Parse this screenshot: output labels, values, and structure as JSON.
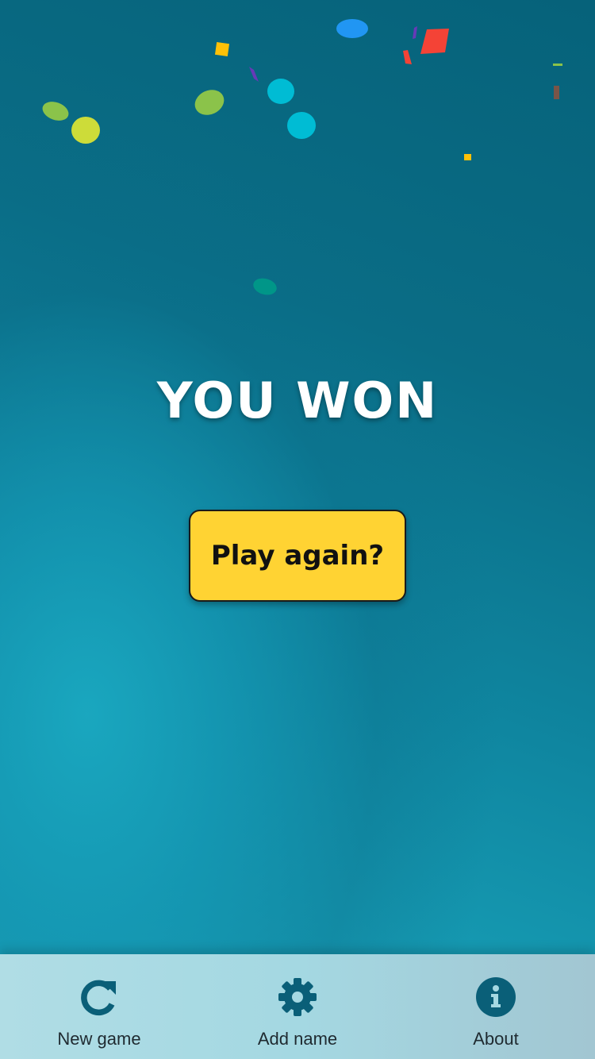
{
  "colors": {
    "background_dark": "#06627a",
    "background_light": "#1aa6bd",
    "title_text": "#ffffff",
    "button_bg": "#ffd333",
    "button_text": "#111111",
    "tab_bar_bg": "#a4d8e2",
    "tab_icon": "#0a5f78",
    "tab_text": "#1f2a30"
  },
  "main": {
    "title": "YOU WON",
    "play_again_label": "Play again?"
  },
  "tabs": [
    {
      "label": "New game",
      "icon": "refresh-icon"
    },
    {
      "label": "Add name",
      "icon": "gear-icon"
    },
    {
      "label": "About",
      "icon": "info-icon"
    }
  ],
  "confetti_colors": [
    "#8bc34a",
    "#cddc39",
    "#00bcd4",
    "#2196f3",
    "#f44336",
    "#ffc107",
    "#673ab7",
    "#009688",
    "#795548"
  ]
}
